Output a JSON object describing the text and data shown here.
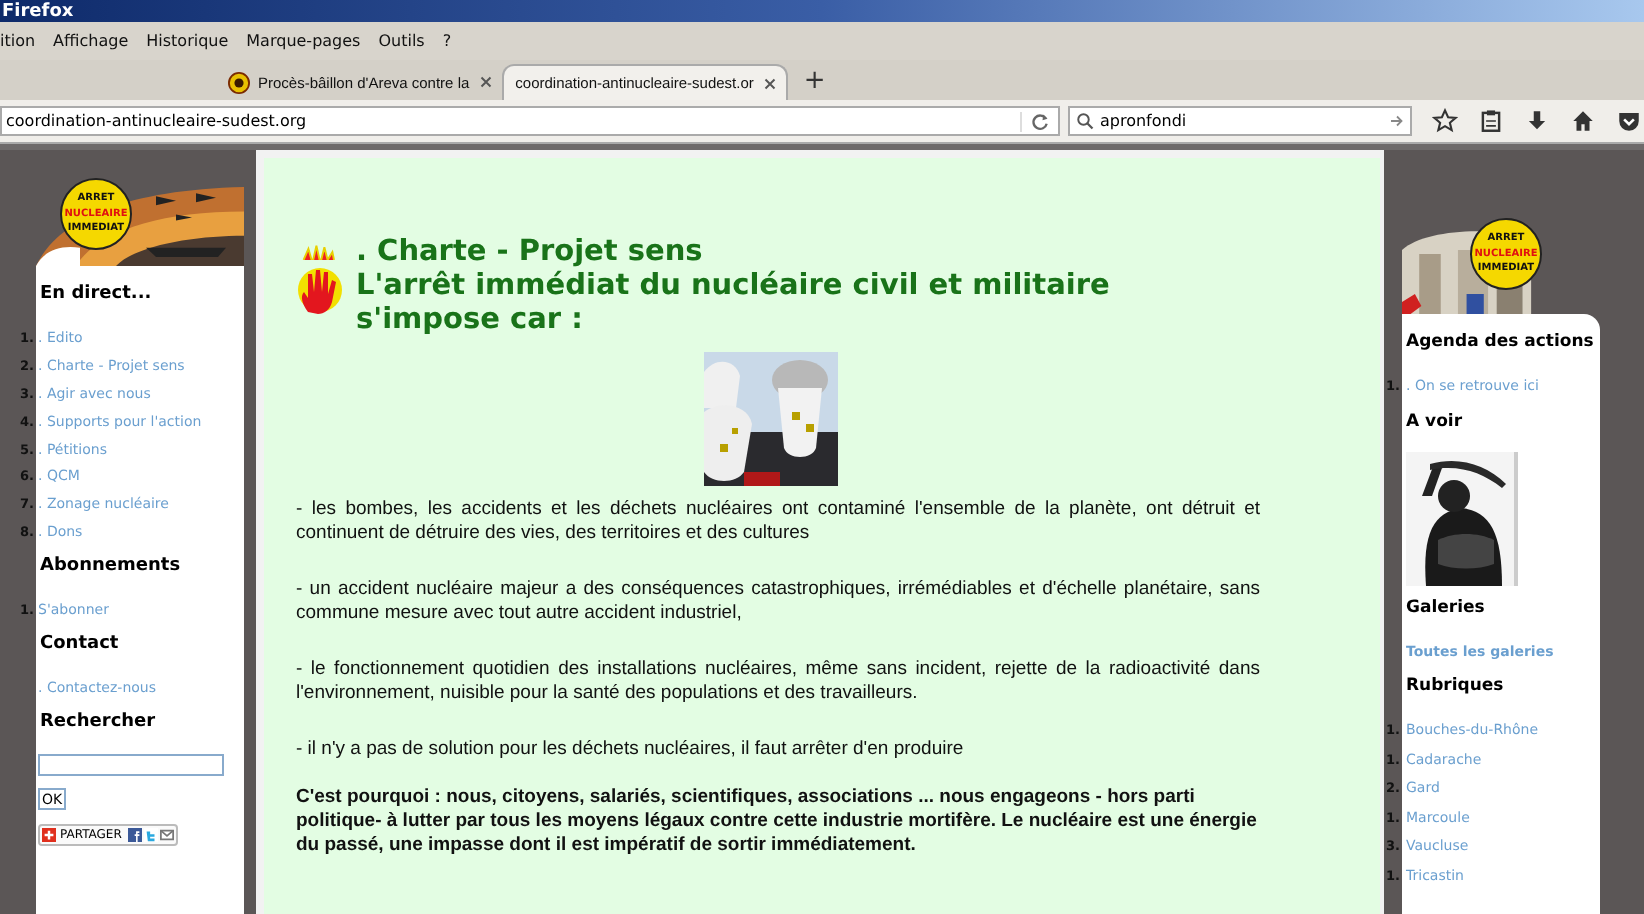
{
  "window": {
    "title": "Firefox"
  },
  "menu": [
    "ition",
    "Affichage",
    "Historique",
    "Marque-pages",
    "Outils",
    "?"
  ],
  "tabs": [
    {
      "label": "Procès-bâillon d'Areva contre la",
      "selected": false
    },
    {
      "label": "coordination-antinucleaire-sudest.or",
      "selected": true
    }
  ],
  "new_tab": "+",
  "address": {
    "value": "coordination-antinucleaire-sudest.org"
  },
  "search": {
    "value": "apronfondi"
  },
  "logos": [
    {
      "top": "ARRET",
      "middle": "NUCLEAIRE",
      "bottom": "IMMEDIAT"
    },
    {
      "top": "ARRET",
      "middle": "NUCLEAIRE",
      "bottom": "IMMEDIAT"
    }
  ],
  "left_sidebar": {
    "sections": [
      {
        "title": "En direct...",
        "items": [
          {
            "number": "1.",
            "label": ". Edito"
          },
          {
            "number": "2.",
            "label": ". Charte - Projet sens"
          },
          {
            "number": "3.",
            "label": ". Agir avec nous"
          },
          {
            "number": "4.",
            "label": ". Supports pour l'action"
          },
          {
            "number": "5.",
            "label": ". Pétitions"
          },
          {
            "number": "6.",
            "label": ". QCM"
          },
          {
            "number": "7.",
            "label": ". Zonage nucléaire"
          },
          {
            "number": "8.",
            "label": ". Dons"
          }
        ]
      },
      {
        "title": "Abonnements",
        "items": [
          {
            "number": "1.",
            "label": "S'abonner"
          }
        ]
      },
      {
        "title": "Contact",
        "items": [
          {
            "label": ". Contactez-nous"
          }
        ]
      }
    ],
    "search": {
      "title": "Rechercher",
      "button": "OK"
    },
    "share": {
      "label": "PARTAGER"
    }
  },
  "article": {
    "kicker": ". Charte - Projet sens",
    "title": "L'arrêt immédiat du nucléaire civil et militaire s'impose car :",
    "paragraphs": [
      {
        "text": "- les bombes, les accidents et les déchets nucléaires ont contaminé l'ensemble de la planète, ont détruit  et continuent de détruire des vies, des territoires et des cultures",
        "bold": false
      },
      {
        "text": "- un accident nucléaire majeur a des conséquences catastrophiques, irrémédiables et d'échelle planétaire, sans commune mesure avec tout autre accident industriel,",
        "bold": false
      },
      {
        "text": "- le fonctionnement quotidien des installations nucléaires, même sans incident, rejette de la radioactivité  dans l'environnement, nuisible pour la santé des populations et des travailleurs.",
        "bold": false
      },
      {
        "text": "- il n'y a pas de solution pour les déchets nucléaires, il faut arrêter d'en produire",
        "bold": false
      },
      {
        "text": "C'est pourquoi : nous, citoyens, salariés, scientifiques, associations ... nous engageons - hors parti politique- à lutter par tous les moyens légaux contre cette industrie mortifère.  Le nucléaire est une énergie du passé, une impasse dont il est impératif de sortir immédiatement.",
        "bold": true
      }
    ]
  },
  "right_sidebar": {
    "sections": [
      {
        "title": "Agenda des actions",
        "kind": "list",
        "items": [
          {
            "number": "1.",
            "label": ". On se retrouve ici"
          }
        ]
      },
      {
        "title": "A voir"
      },
      {
        "title": "Galeries",
        "kind": "link",
        "items": [
          {
            "label": "Toutes les galeries"
          }
        ]
      },
      {
        "title": "Rubriques",
        "kind": "list",
        "items": [
          {
            "number": "1.",
            "label": "Bouches-du-Rhône"
          },
          {
            "number": "1.",
            "label": "Cadarache"
          },
          {
            "number": "2.",
            "label": "Gard"
          },
          {
            "number": "1.",
            "label": "Marcoule"
          },
          {
            "number": "3.",
            "label": "Vaucluse"
          },
          {
            "number": "1.",
            "label": "Tricastin"
          }
        ]
      }
    ]
  }
}
